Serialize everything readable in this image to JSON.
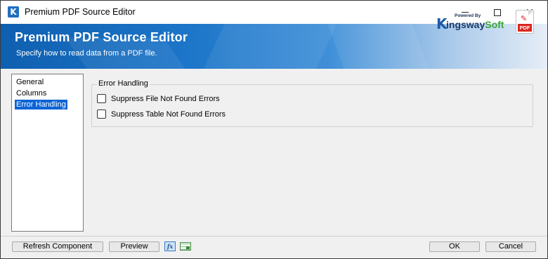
{
  "window": {
    "title": "Premium PDF Source Editor",
    "app_icon_letter": "K",
    "controls": {
      "minimize": "minimize-icon",
      "maximize": "maximize-icon",
      "close": "✕"
    }
  },
  "banner": {
    "title": "Premium PDF Source Editor",
    "subtitle": "Specify how to read data from a PDF file.",
    "brand": {
      "powered_by": "Powered By",
      "logo_letter": "K",
      "name_main": "ingsway",
      "name_accent": "Soft"
    },
    "pdf_icon": {
      "glyph": "ℒ",
      "label": "PDF"
    },
    "colors": {
      "gradient_start": "#0f5fb0",
      "gradient_end": "#e6eef7"
    }
  },
  "nav": {
    "items": [
      {
        "label": "General",
        "selected": false
      },
      {
        "label": "Columns",
        "selected": false
      },
      {
        "label": "Error Handling",
        "selected": true
      }
    ]
  },
  "error_handling": {
    "group_title": "Error Handling",
    "options": [
      {
        "label": "Suppress File Not Found Errors",
        "checked": false
      },
      {
        "label": "Suppress Table Not Found Errors",
        "checked": false
      }
    ]
  },
  "footer": {
    "refresh_label": "Refresh Component",
    "preview_label": "Preview",
    "fx_label": "fx",
    "ok_label": "OK",
    "cancel_label": "Cancel",
    "icons": [
      "expression-icon",
      "data-grid-icon"
    ]
  }
}
